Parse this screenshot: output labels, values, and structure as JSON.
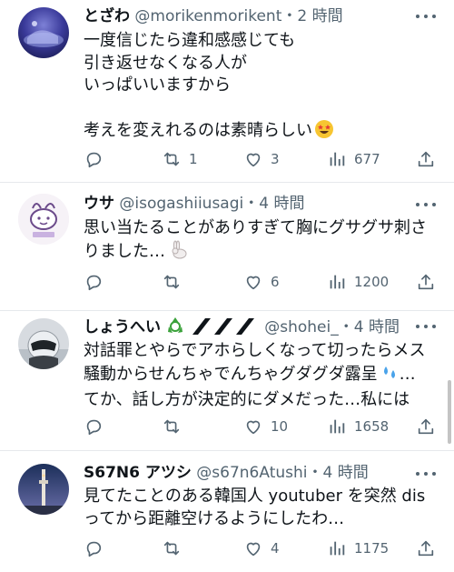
{
  "tweets": [
    {
      "display_name": "とざわ",
      "handle": "@morikenmorikent",
      "separator": "・",
      "time": "2 時間",
      "lines": [
        "一度信じたら違和感感じても",
        "引き返せなくなる人が",
        "いっぱいいますから",
        "",
        "考えを変えれるのは素晴らしい"
      ],
      "counts": {
        "replies": "",
        "reposts": "1",
        "likes": "3",
        "views": "677"
      }
    },
    {
      "display_name": "ウサ",
      "handle": "@isogashiiusagi",
      "separator": "・",
      "time": "4 時間",
      "lines": [
        "思い当たることがありすぎて胸にグサグサ刺さ",
        "りました…"
      ],
      "counts": {
        "replies": "",
        "reposts": "",
        "likes": "6",
        "views": "1200"
      }
    },
    {
      "display_name": "しょうへい",
      "handle": "@shohei_",
      "separator": "・",
      "time": "4 時間",
      "lines": [
        "対話罪とやらでアホらしくなって切ったらメス",
        "騒動からせんちゃでんちゃグダグダ露呈",
        "てか、話し方が決定的にダメだった…私には"
      ],
      "counts": {
        "replies": "",
        "reposts": "",
        "likes": "10",
        "views": "1658"
      }
    },
    {
      "display_name": "S67N6 アツシ",
      "handle": "@s67n6Atushi",
      "separator": "・",
      "time": "4 時間",
      "lines": [
        "見てたことのある韓国人 youtuber を突然 dis",
        "ってから距離空けるようにしたわ…"
      ],
      "counts": {
        "replies": "",
        "reposts": "",
        "likes": "4",
        "views": "1175"
      }
    }
  ],
  "icons": {
    "reply": "reply-icon",
    "repost": "repost-icon",
    "like": "heart-icon",
    "views": "views-icon",
    "share": "share-icon",
    "more": "more-icon"
  },
  "colors": {
    "text": "#0f1419",
    "secondary": "#536471",
    "divider": "#e6e9ec",
    "recycle": "#3aa13a"
  }
}
